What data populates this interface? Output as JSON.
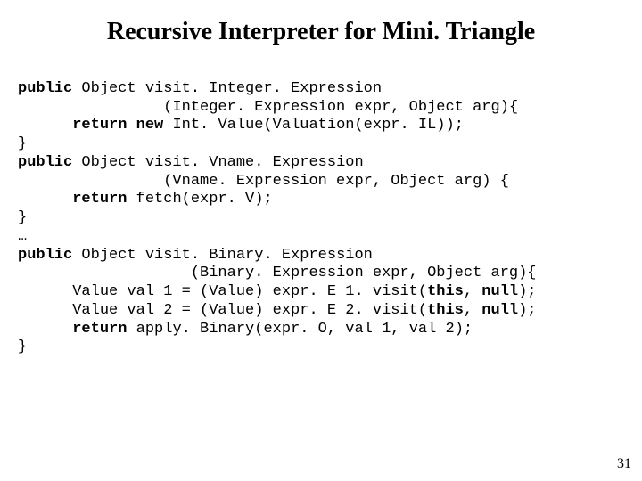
{
  "title": "Recursive Interpreter for Mini. Triangle",
  "page_number": "31",
  "code": {
    "l1_kw": "public",
    "l1_rest": " Object visit. Integer. Expression",
    "l2": "                (Integer. Expression expr, Object arg){",
    "l3_kw1": "return",
    "l3_kw2": "new",
    "l3_rest": " Int. Value(Valuation(expr. IL));",
    "l4": "}",
    "l5_kw": "public",
    "l5_rest": " Object visit. Vname. Expression",
    "l6": "                (Vname. Expression expr, Object arg) {",
    "l7_kw": "return",
    "l7_rest": " fetch(expr. V);",
    "l8": "}",
    "l9": "…",
    "l10_kw": "public",
    "l10_rest": " Object visit. Binary. Expression",
    "l11": "                   (Binary. Expression expr, Object arg){",
    "l12a": "      Value val 1 = (Value) expr. E 1. visit(",
    "l12_kw1": "this",
    "l12b": ", ",
    "l12_kw2": "null",
    "l12c": ");",
    "l13a": "      Value val 2 = (Value) expr. E 2. visit(",
    "l13_kw1": "this",
    "l13b": ", ",
    "l13_kw2": "null",
    "l13c": ");",
    "l14_kw": "return",
    "l14_rest": " apply. Binary(expr. O, val 1, val 2);",
    "l15": "}"
  }
}
